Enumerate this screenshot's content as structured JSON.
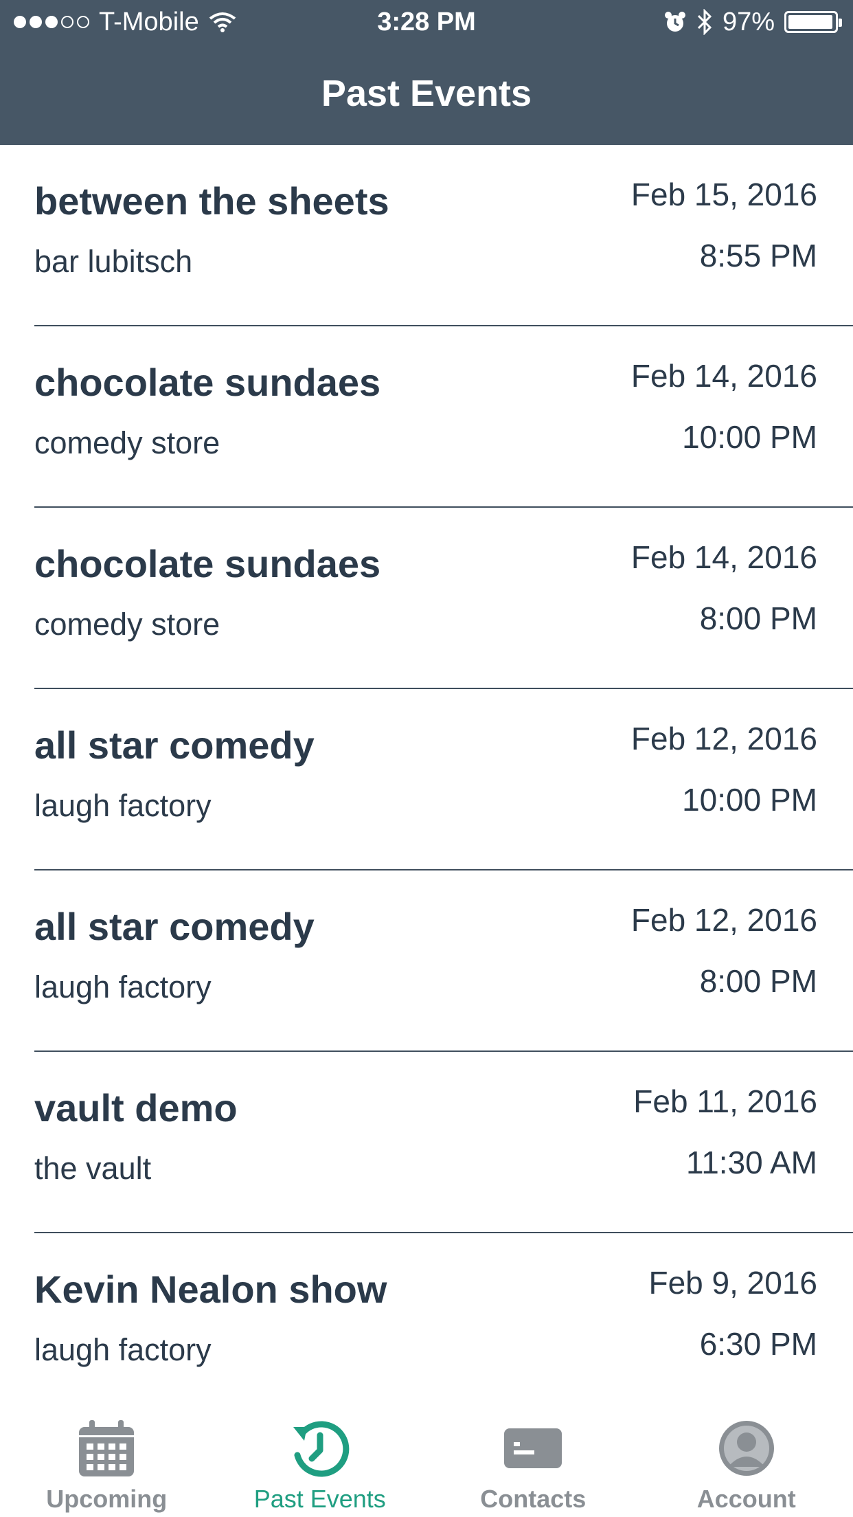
{
  "status_bar": {
    "carrier": "T-Mobile",
    "time": "3:28 PM",
    "battery": "97%",
    "signal_bars_filled": 3,
    "signal_bars_total": 5
  },
  "header": {
    "title": "Past Events"
  },
  "events": [
    {
      "name": "between the sheets",
      "venue": "bar lubitsch",
      "date": "Feb 15, 2016",
      "time": "8:55 PM"
    },
    {
      "name": "chocolate sundaes",
      "venue": "comedy store",
      "date": "Feb 14, 2016",
      "time": "10:00 PM"
    },
    {
      "name": "chocolate sundaes",
      "venue": "comedy store",
      "date": "Feb 14, 2016",
      "time": "8:00 PM"
    },
    {
      "name": "all star comedy",
      "venue": "laugh factory",
      "date": "Feb 12, 2016",
      "time": "10:00 PM"
    },
    {
      "name": "all star comedy",
      "venue": "laugh factory",
      "date": "Feb 12, 2016",
      "time": "8:00 PM"
    },
    {
      "name": "vault demo",
      "venue": "the vault",
      "date": "Feb 11, 2016",
      "time": "11:30 AM"
    },
    {
      "name": "Kevin Nealon show",
      "venue": "laugh factory",
      "date": "Feb 9, 2016",
      "time": "6:30 PM"
    }
  ],
  "tabs": [
    {
      "label": "Upcoming",
      "icon": "calendar-icon",
      "active": false
    },
    {
      "label": "Past Events",
      "icon": "history-icon",
      "active": true
    },
    {
      "label": "Contacts",
      "icon": "contact-card-icon",
      "active": false
    },
    {
      "label": "Account",
      "icon": "user-icon",
      "active": false
    }
  ],
  "colors": {
    "header_bg": "#475766",
    "text": "#2b3a4a",
    "active_tab": "#1f9e81",
    "inactive_tab": "#8a8f94"
  }
}
